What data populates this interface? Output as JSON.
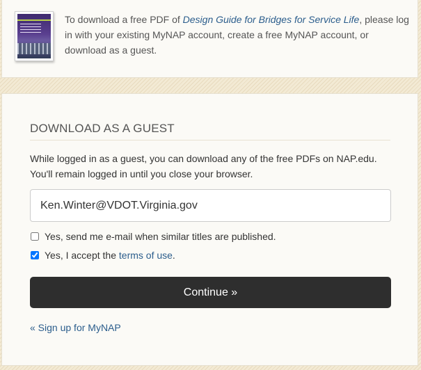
{
  "intro": {
    "prefix": "To download a free PDF of ",
    "book_title": "Design Guide for Bridges for Service Life",
    "suffix": ", please log in with your existing MyNAP account, create a free MyNAP account, or download as a guest."
  },
  "guest": {
    "heading": "DOWNLOAD AS A GUEST",
    "description": "While logged in as a guest, you can download any of the free PDFs on NAP.edu. You'll remain logged in until you close your browser.",
    "email_value": "Ken.Winter@VDOT.Virginia.gov",
    "email_checkbox": {
      "label": "Yes, send me e-mail when similar titles are published.",
      "checked": false
    },
    "terms_checkbox": {
      "label_prefix": "Yes, I accept the ",
      "link": "terms of use",
      "label_suffix": ".",
      "checked": true
    },
    "continue_label": "Continue »",
    "signup_link": "« Sign up for MyNAP"
  },
  "colors": {
    "accent_link": "#2b5d8c",
    "button_bg": "#2e2e2e",
    "page_bg": "#f3ead4"
  }
}
